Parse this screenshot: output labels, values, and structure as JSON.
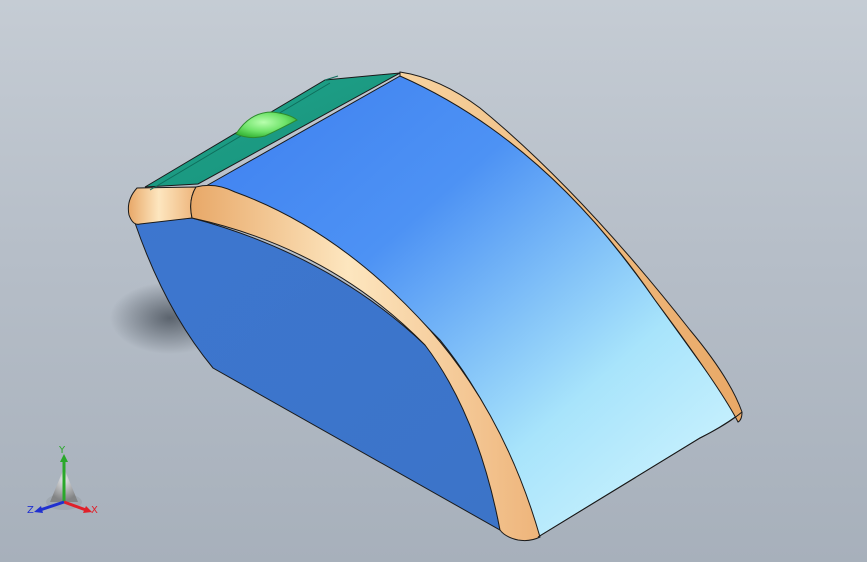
{
  "viewport": {
    "background_top": "#c5ccd4",
    "background_bottom": "#a7b0bb"
  },
  "model": {
    "colors": {
      "top_face": "#1fa187",
      "fillet": "#f2c080",
      "front_face_light": "#c8f2ff",
      "front_face_dark": "#3f84f0",
      "side_face": "#3f78cc",
      "button": "#6fe36a",
      "edge": "#1a1a1a"
    }
  },
  "triad": {
    "labels": {
      "x": "X",
      "y": "Y",
      "z": "Z"
    },
    "colors": {
      "x": "#e0202a",
      "y": "#2aa82a",
      "z": "#2030d0"
    }
  }
}
